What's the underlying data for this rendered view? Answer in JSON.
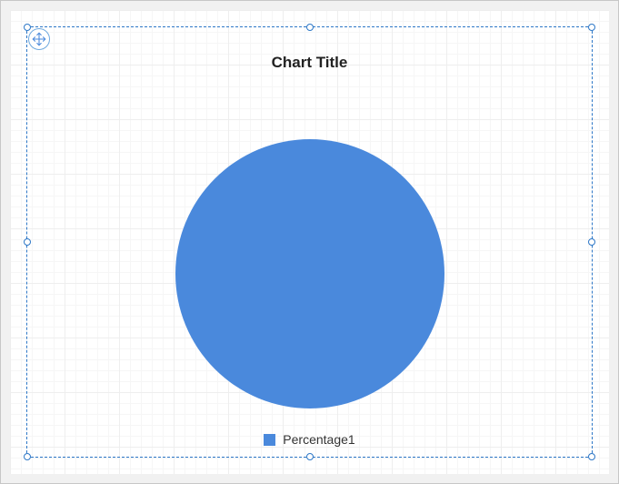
{
  "title": "Chart Title",
  "legend": {
    "items": [
      {
        "label": "Percentage1",
        "color": "#4a89dc"
      }
    ]
  },
  "chart_data": {
    "type": "pie",
    "title": "Chart Title",
    "series": [
      {
        "name": "Percentage1",
        "values": [
          100
        ],
        "color": "#4a89dc"
      }
    ],
    "categories": [
      "Percentage1"
    ]
  },
  "colors": {
    "selection": "#2d77c7",
    "series0": "#4a89dc"
  }
}
